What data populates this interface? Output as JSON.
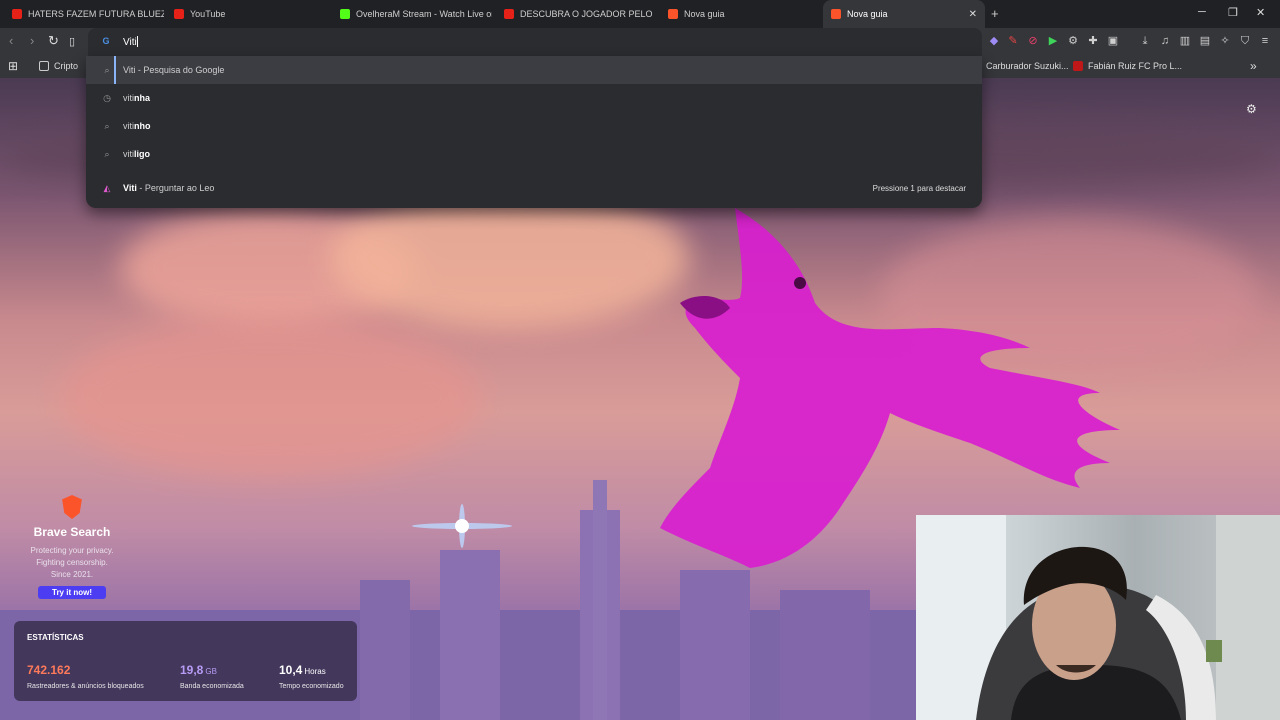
{
  "tabs": [
    {
      "title": "HATERS FAZEM FUTURA BLUEZETE D",
      "icon": "youtube-icon"
    },
    {
      "title": "YouTube",
      "icon": "youtube-icon"
    },
    {
      "title": "OvelheraM Stream - Watch Live on K",
      "icon": "kick-icon"
    },
    {
      "title": "DESCUBRA O JOGADOR PELO CABEL",
      "icon": "youtube-icon"
    },
    {
      "title": "Nova guia",
      "icon": "brave-icon"
    },
    {
      "title": "Nova guia",
      "icon": "brave-icon",
      "active": true
    }
  ],
  "omnibox": {
    "value": "Viti"
  },
  "bookmarks": [
    {
      "label": "Cripto",
      "icon": "folder-icon"
    },
    {
      "label": "Carburador Suzuki...",
      "icon": "page-icon"
    },
    {
      "label": "Fabián Ruiz FC Pro L...",
      "icon": "page-icon"
    }
  ],
  "suggestions": [
    {
      "bold": "Viti",
      "rest": " - Pesquisa do Google",
      "icon": "search-icon",
      "selected": true
    },
    {
      "prefix": "viti",
      "bold": "nha",
      "icon": "history-icon"
    },
    {
      "prefix": "viti",
      "bold": "nho",
      "icon": "search-icon"
    },
    {
      "prefix": "viti",
      "bold": "ligo",
      "icon": "search-icon"
    },
    {
      "bold": "Viti",
      "rest": " - Perguntar ao Leo",
      "icon": "leo-icon",
      "hint": "Pressione 1 para destacar"
    }
  ],
  "promo": {
    "title": "Brave Search",
    "lines": [
      "Protecting your privacy.",
      "Fighting censorship.",
      "Since 2021."
    ],
    "button": "Try it now!"
  },
  "stats": {
    "title": "ESTATÍSTICAS",
    "items": [
      {
        "value": "742.162",
        "unit": "",
        "label": "Rastreadores & anúncios bloqueados",
        "color": "#ff7a5a"
      },
      {
        "value": "19,8",
        "unit": "GB",
        "label": "Banda economizada",
        "color": "#b79cf5"
      },
      {
        "value": "10,4",
        "unit": "Horas",
        "label": "Tempo economizado",
        "color": "#ffffff"
      }
    ]
  },
  "colors": {
    "accent": "#8ab4f8",
    "brave": "#fb542b",
    "promo_button": "#4c3df2",
    "parrot": "#d81ecf"
  }
}
